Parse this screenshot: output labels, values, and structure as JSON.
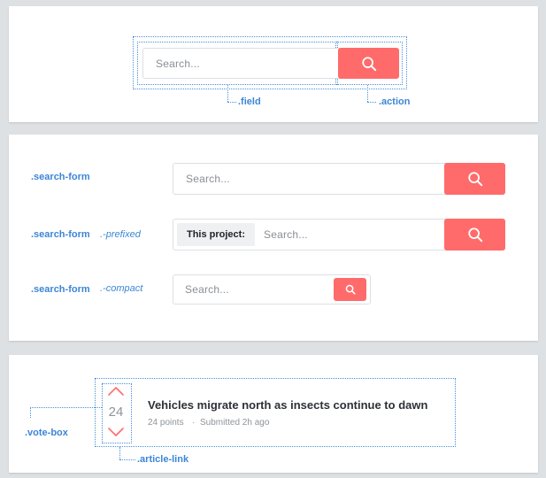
{
  "colors": {
    "accent": "#ff6b6b",
    "annotation": "#3b86d6",
    "background": "#dde1e4"
  },
  "panel1": {
    "search_placeholder": "Search...",
    "search_button_icon": "search-icon",
    "label_field": ".field",
    "label_action": ".action"
  },
  "panel2": {
    "rows": [
      {
        "name": ".search-form",
        "modifier": "",
        "placeholder": "Search..."
      },
      {
        "name": ".search-form",
        "modifier": ".-prefixed",
        "prefix": "This project:",
        "placeholder": "Search..."
      },
      {
        "name": ".search-form",
        "modifier": ".-compact",
        "placeholder": "Search..."
      }
    ]
  },
  "panel3": {
    "vote_count": "24",
    "title": "Vehicles migrate north as insects continue to dawn",
    "points": "24 points",
    "separator": "·",
    "submitted": "Submitted 2h ago",
    "label_vote_box": ".vote-box",
    "label_article_link": ".article-link"
  }
}
